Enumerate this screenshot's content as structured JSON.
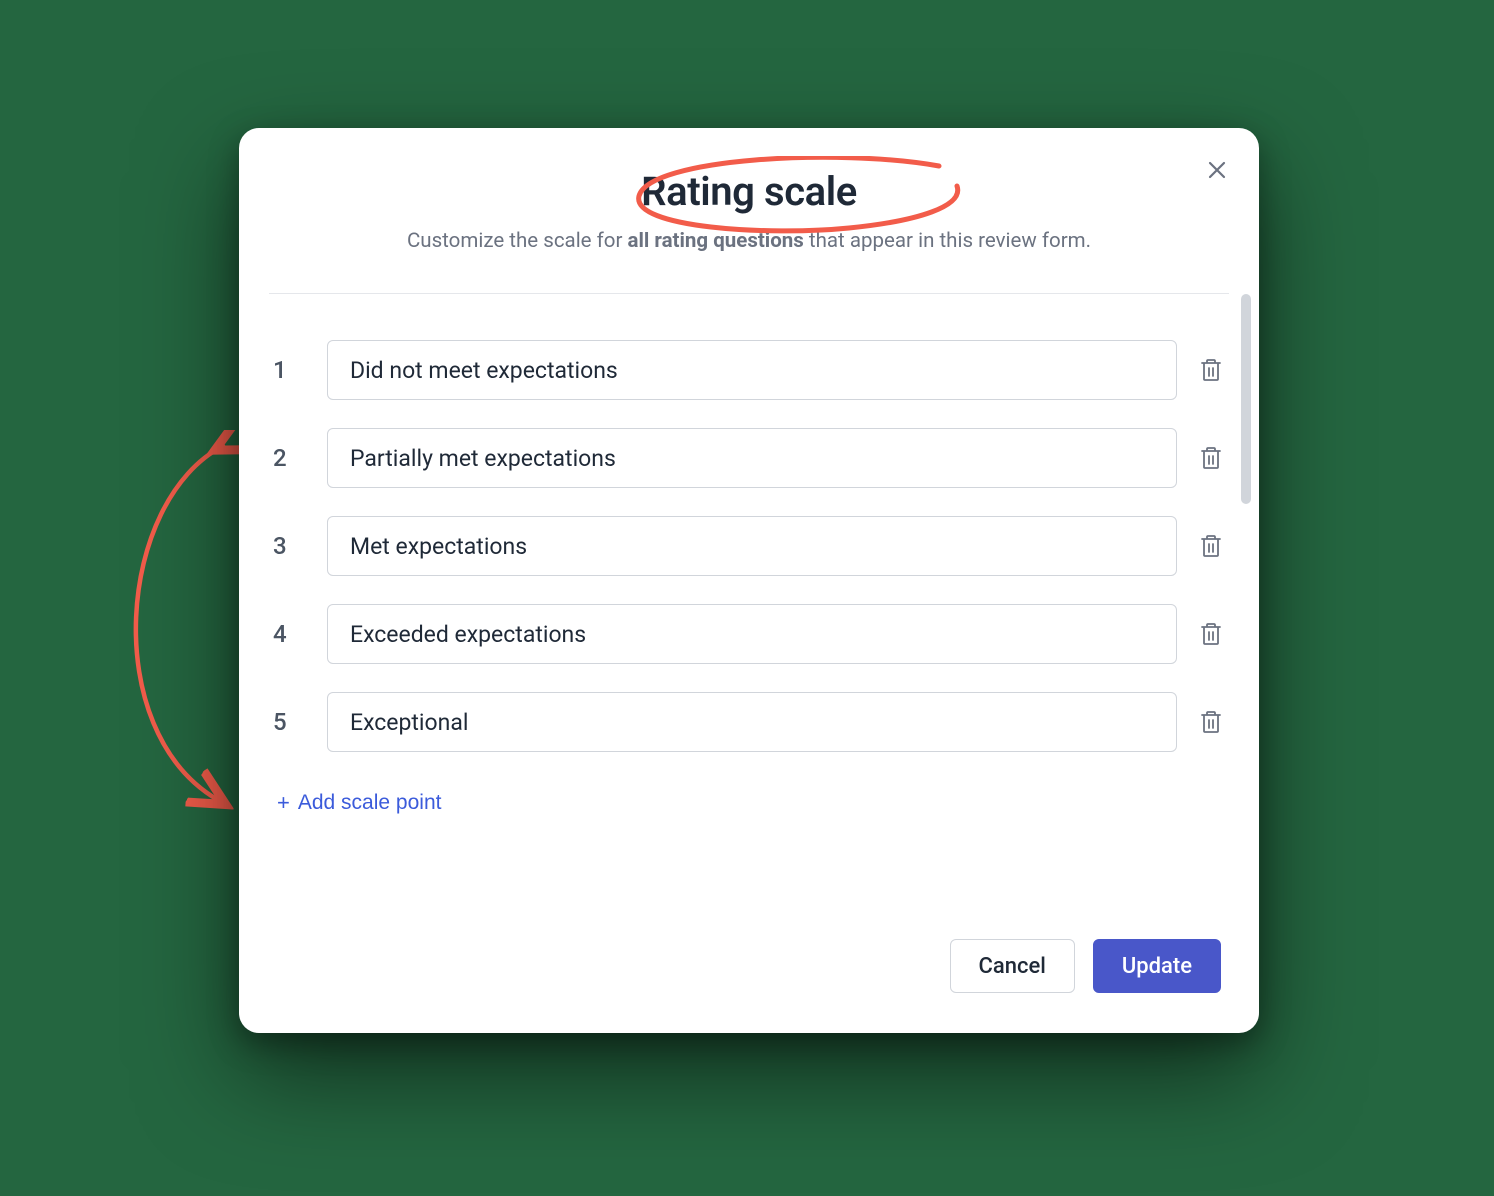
{
  "modal": {
    "title": "Rating scale",
    "subtitle_prefix": "Customize the scale for ",
    "subtitle_bold": "all rating questions",
    "subtitle_suffix": " that appear in this review form.",
    "rows": [
      {
        "num": "1",
        "label": "Did not meet expectations"
      },
      {
        "num": "2",
        "label": "Partially met expectations"
      },
      {
        "num": "3",
        "label": "Met expectations"
      },
      {
        "num": "4",
        "label": "Exceeded expectations"
      },
      {
        "num": "5",
        "label": "Exceptional"
      }
    ],
    "add_label": "Add scale point",
    "cancel_label": "Cancel",
    "update_label": "Update"
  },
  "annotation": {
    "circle_color": "#f25c4a",
    "arrow_color": "#f25c4a"
  }
}
